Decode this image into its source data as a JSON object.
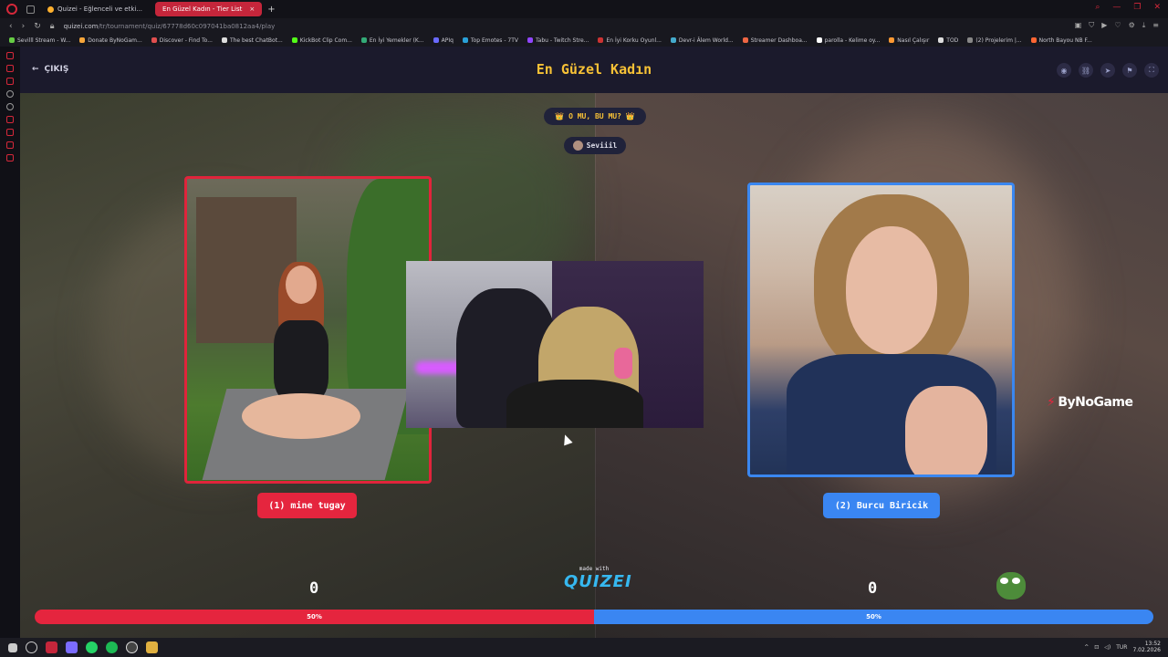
{
  "browser": {
    "tabs": [
      {
        "label": "Quizei - Eğlenceli ve etki...",
        "active": false
      },
      {
        "label": "En Güzel Kadın - Tier List",
        "active": true
      }
    ],
    "url_host": "quizei.com",
    "url_path": "/tr/tournament/quiz/67778d60c097041ba0812aa4/play",
    "bookmarks": [
      "Sevilll Stream - W...",
      "Donate ByNoGam...",
      "Discover - Find To...",
      "The best ChatBot...",
      "KickBot Clip Com...",
      "En İyi Yemekler (K...",
      "APIq",
      "Top Emotes - 7TV",
      "Tabu - Twitch Stre...",
      "En İyi Korku Oyunl...",
      "Devr-i Âlem World...",
      "Streamer Dashboa...",
      "parolla - Kelime oy...",
      "Nasıl Çalışır",
      "TOD",
      "(2) Projelerim |...",
      "North Bayou NB F..."
    ]
  },
  "header": {
    "back_label": "ÇIKIŞ",
    "title": "En Güzel Kadın"
  },
  "prompt": "👑 O MU, BU MU? 👑",
  "user": "Seviiil",
  "left": {
    "label": "(1) mine tugay",
    "score": "0",
    "percent_label": "50%",
    "share": 0.5
  },
  "right": {
    "label": "(2) Burcu Biricik",
    "score": "0",
    "percent_label": "50%",
    "share": 0.5
  },
  "made_with": {
    "small": "made with",
    "brand": "QUIZEI"
  },
  "watermark": "ByNoGame",
  "taskbar": {
    "lang": "TUR",
    "time": "13:52",
    "date": "7.02.2026"
  },
  "colors": {
    "left_accent": "#e5253e",
    "right_accent": "#3a86f2",
    "title": "#f7c136"
  }
}
